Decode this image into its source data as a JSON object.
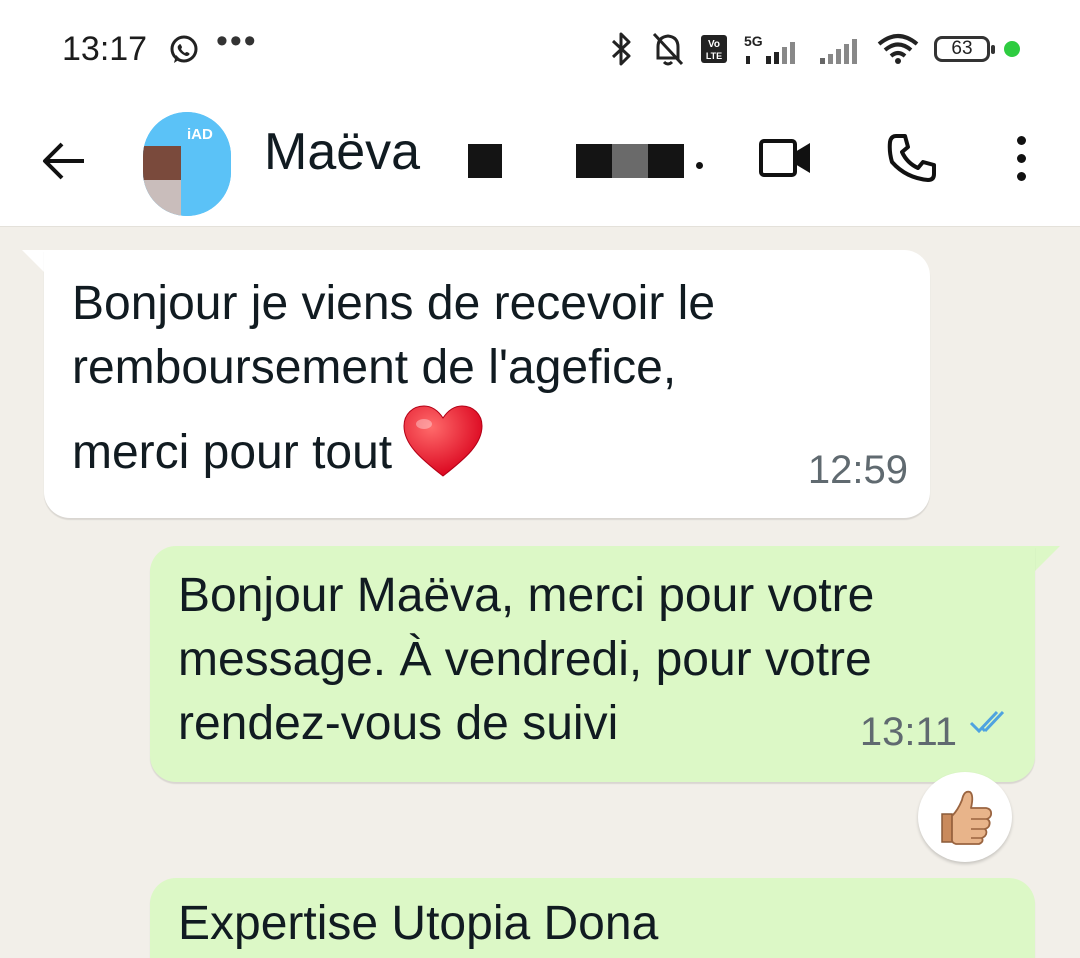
{
  "status_bar": {
    "time": "13:17",
    "more_indicator": "•••",
    "network": "5G",
    "volte": "Vo LTE",
    "battery": "63",
    "icons": [
      "whatsapp-icon",
      "bluetooth-icon",
      "bell-off-icon",
      "signal-icon",
      "wifi-icon",
      "battery-icon"
    ]
  },
  "header": {
    "contact_name": "Maëva",
    "avatar_text": "iAD",
    "icons": [
      "back-arrow-icon",
      "video-call-icon",
      "phone-call-icon",
      "more-vert-icon"
    ]
  },
  "messages": [
    {
      "direction": "incoming",
      "lines": [
        "Bonjour je viens de recevoir le",
        "remboursement de l'agefice,",
        "merci pour tout"
      ],
      "emoji": "heart-icon",
      "time": "12:59"
    },
    {
      "direction": "outgoing",
      "lines": [
        "Bonjour Maëva, merci pour votre",
        "message. À vendredi, pour votre",
        "rendez-vous de suivi"
      ],
      "time": "13:11",
      "status": "read",
      "reaction": "thumbs-up-icon"
    },
    {
      "direction": "outgoing",
      "lines": [
        "Expertise Utopia Dona"
      ]
    }
  ],
  "colors": {
    "chat_background": "#f2efe9",
    "outgoing_bubble": "#dcf8c6",
    "incoming_bubble": "#ffffff",
    "read_ticks": "#4fa3e0"
  }
}
